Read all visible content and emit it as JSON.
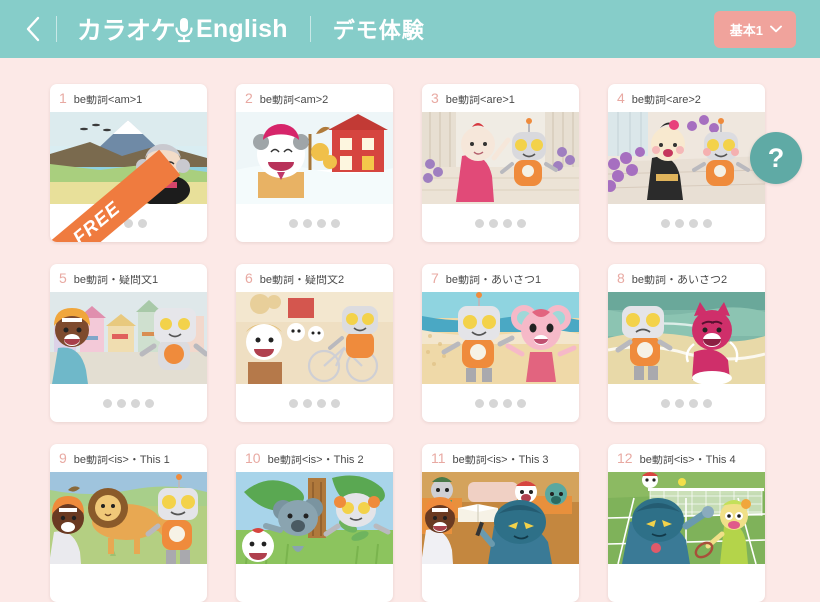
{
  "header": {
    "back_icon": "chevron-left-icon",
    "brand_jp": "カラオケ",
    "brand_mic_icon": "microphone-icon",
    "brand_en": "English",
    "subtitle": "デモ体験",
    "level_button": {
      "label": "基本1",
      "chevron_icon": "chevron-down-icon"
    },
    "bg_color": "#86cdc9",
    "level_button_color": "#f0a39c"
  },
  "page": {
    "background_color": "#fce9e7",
    "help_button": {
      "label": "?",
      "icon": "question-mark-icon",
      "color": "#5faaa5"
    }
  },
  "lessons": [
    {
      "number": "1",
      "title": "be動詞<am>1",
      "dots": 3,
      "badge": "FREE",
      "scene": "mount-fuji-girl-kimono"
    },
    {
      "number": "2",
      "title": "be動詞<am>2",
      "dots": 4,
      "badge": null,
      "scene": "snow-barn-bear"
    },
    {
      "number": "3",
      "title": "be動詞<are>1",
      "dots": 4,
      "badge": null,
      "scene": "wisteria-girl-robot"
    },
    {
      "number": "4",
      "title": "be動詞<are>2",
      "dots": 4,
      "badge": null,
      "scene": "flower-path-girl-robot"
    },
    {
      "number": "5",
      "title": "be動詞・疑問文1",
      "dots": 4,
      "badge": null,
      "scene": "town-street-boy-robot"
    },
    {
      "number": "6",
      "title": "be動詞・疑問文2",
      "dots": 4,
      "badge": null,
      "scene": "bicycle-farm-bear-robot"
    },
    {
      "number": "7",
      "title": "be動詞・あいさつ1",
      "dots": 4,
      "badge": null,
      "scene": "beach-robot-mouse"
    },
    {
      "number": "8",
      "title": "be動詞・あいさつ2",
      "dots": 4,
      "badge": null,
      "scene": "beach-robot-pink-monster"
    },
    {
      "number": "9",
      "title": "be動詞<is>・This 1",
      "dots": 0,
      "badge": null,
      "scene": "lion-boy-robot"
    },
    {
      "number": "10",
      "title": "be動詞<is>・This 2",
      "dots": 0,
      "badge": null,
      "scene": "koala-tree-robot"
    },
    {
      "number": "11",
      "title": "be動詞<is>・This 3",
      "dots": 0,
      "badge": null,
      "scene": "classroom-study-blue-robot"
    },
    {
      "number": "12",
      "title": "be動詞<is>・This 4",
      "dots": 0,
      "badge": null,
      "scene": "tennis-court-blue-robot"
    }
  ]
}
